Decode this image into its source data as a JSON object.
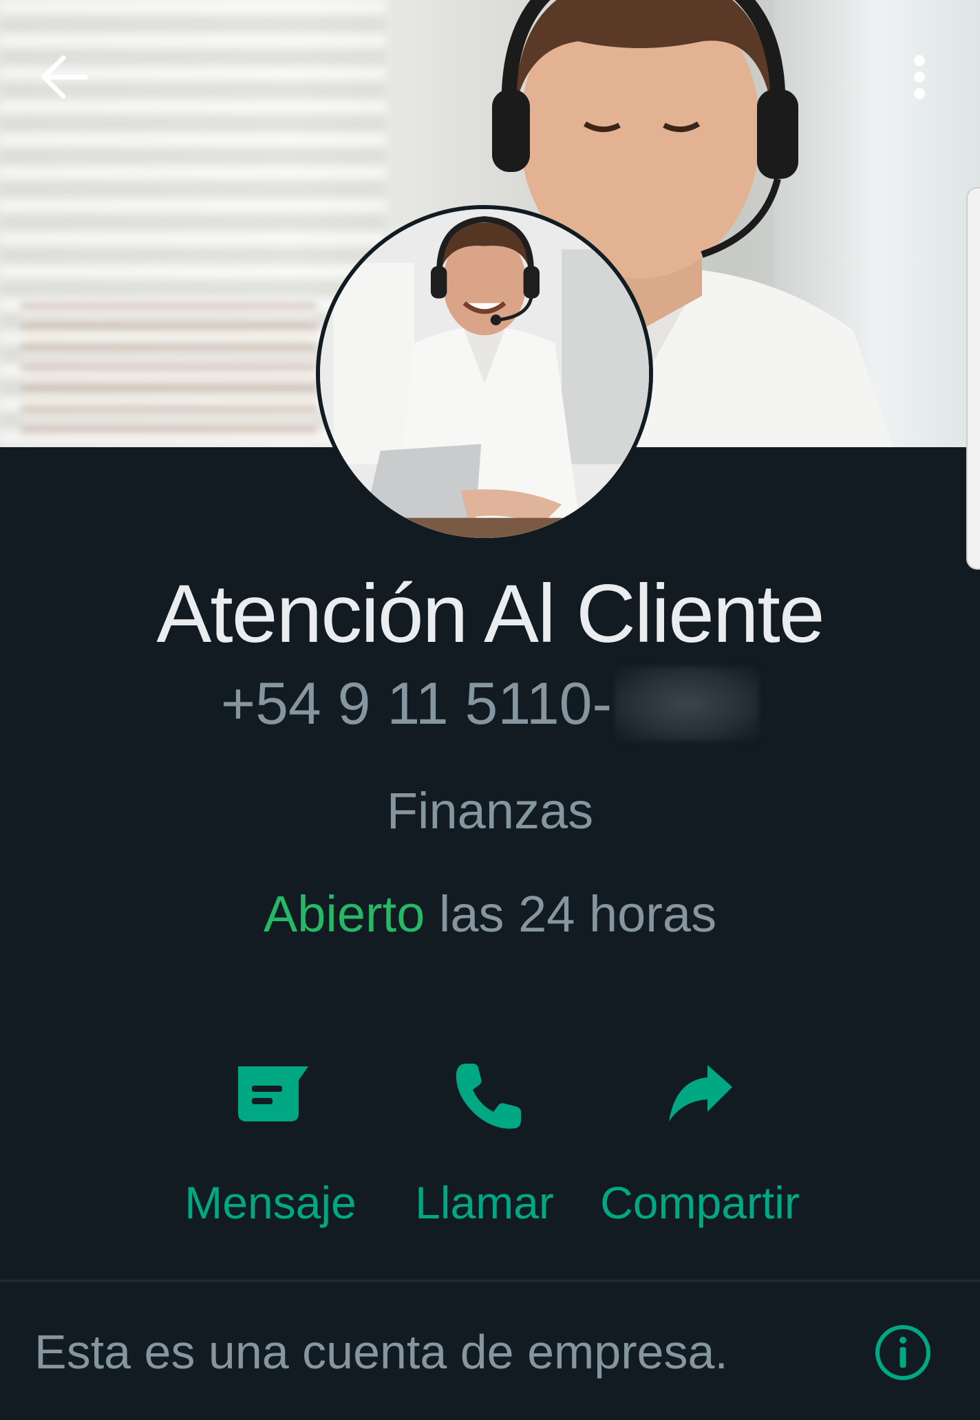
{
  "header": {
    "back_icon": "arrow-left-icon",
    "menu_icon": "more-vertical-icon"
  },
  "profile": {
    "name": "Atención Al Cliente",
    "phone_visible": "+54 9 11 5110-",
    "phone_hidden_note": "blurred",
    "category": "Finanzas",
    "hours_status": "Abierto",
    "hours_text": " las 24 horas"
  },
  "actions": [
    {
      "label": "Mensaje",
      "icon": "message-icon"
    },
    {
      "label": "Llamar",
      "icon": "phone-icon"
    },
    {
      "label": "Compartir",
      "icon": "share-icon"
    }
  ],
  "business_notice": {
    "text": "Esta es una cuenta de empresa.",
    "icon": "info-icon"
  },
  "colors": {
    "background": "#111b21",
    "accent": "#00a884",
    "open_status": "#25b865",
    "secondary_text": "#8696a0",
    "primary_text": "#e9edef"
  }
}
